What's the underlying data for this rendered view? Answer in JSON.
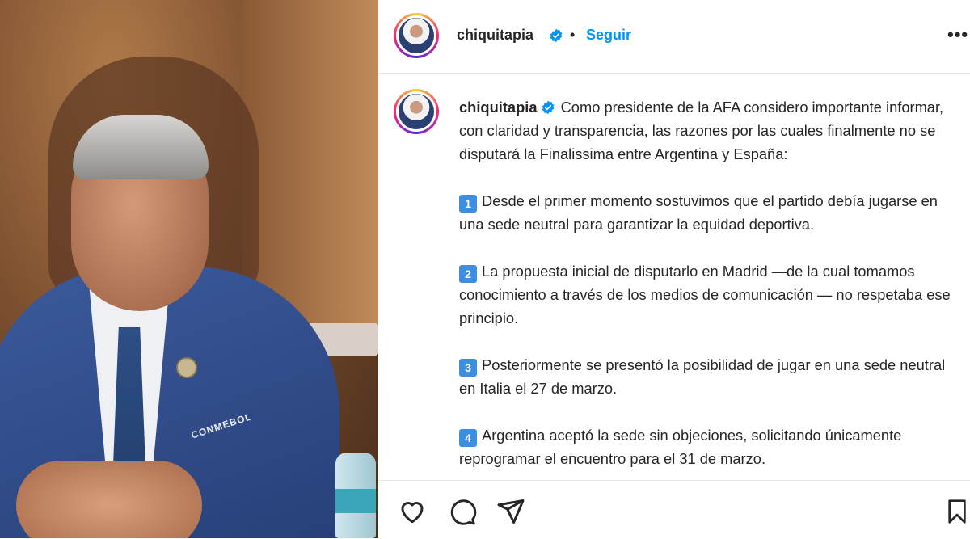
{
  "post": {
    "username": "chiquitapia",
    "follow_label": "Seguir",
    "separator": "•",
    "more_label": "•••",
    "icons": {
      "verified": "verified-badge-icon",
      "like": "heart-icon",
      "comment": "comment-icon",
      "share": "send-icon",
      "save": "bookmark-icon"
    },
    "accent_color": "#0095f6",
    "caption": {
      "intro": "Como presidente de la AFA considero importante informar, con claridad y transparencia, las razones por las cuales finalmente no se disputará la Finalissima entre Argentina y España:",
      "points": [
        {
          "num": "1",
          "text": "Desde el primer momento sostuvimos que el partido debía jugarse en una sede neutral para garantizar la equidad deportiva."
        },
        {
          "num": "2",
          "text": "La propuesta inicial de disputarlo en Madrid —de la cual tomamos conocimiento a través de los medios de comunicación — no respetaba ese principio."
        },
        {
          "num": "3",
          "text": "Posteriormente se presentó la posibilidad de jugar en una sede neutral en Italia el 27 de marzo."
        },
        {
          "num": "4",
          "text": "Argentina aceptó la sede sin objeciones, solicitando únicamente reprogramar el encuentro para el 31 de marzo."
        }
      ]
    }
  },
  "photo": {
    "jacket_text": "CONMEBOL"
  }
}
